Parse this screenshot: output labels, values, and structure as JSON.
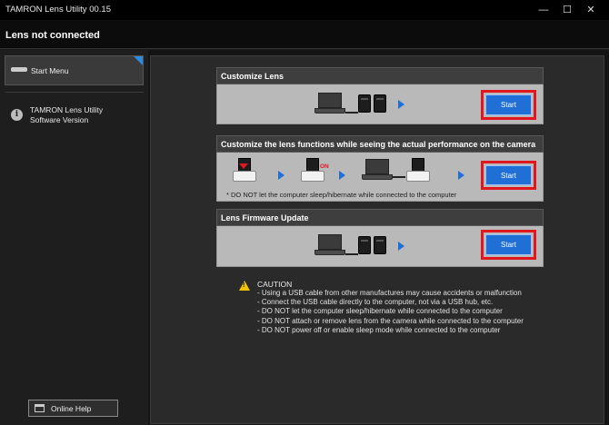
{
  "window": {
    "title": "TAMRON Lens Utility  00.15",
    "minimize_glyph": "—",
    "maximize_glyph": "☐",
    "close_glyph": "✕"
  },
  "status": {
    "text": "Lens not connected"
  },
  "sidebar": {
    "items": [
      {
        "label": "Start Menu",
        "icon": "usb-cable-icon",
        "selected": true
      },
      {
        "label_line1": "TAMRON Lens Utility",
        "label_line2": "Software Version",
        "icon": "info-icon"
      }
    ],
    "help_button": {
      "label": "Online Help",
      "icon": "window-icon"
    }
  },
  "sections": {
    "customize": {
      "title": "Customize Lens",
      "start_label": "Start"
    },
    "camera": {
      "title": "Customize the lens functions while seeing the actual performance on the camera",
      "start_label": "Start",
      "on_label": "ON",
      "note": "* DO NOT let the computer sleep/hibernate while connected to the computer"
    },
    "firmware": {
      "title": "Lens Firmware Update",
      "start_label": "Start"
    }
  },
  "caution": {
    "title": "CAUTION",
    "items": [
      "- Using a USB cable from other manufactures may cause accidents or malfunction",
      "- Connect the USB cable directly to the computer, not via a USB hub, etc.",
      "- DO NOT let the computer sleep/hibernate while connected to the computer",
      "- DO NOT attach or remove lens from the camera while connected to the computer",
      "- DO NOT power off or enable sleep mode while connected to the computer"
    ]
  },
  "colors": {
    "accent_blue": "#1f6fd6",
    "highlight_red": "#e0171f",
    "warning_yellow": "#f2c500"
  }
}
